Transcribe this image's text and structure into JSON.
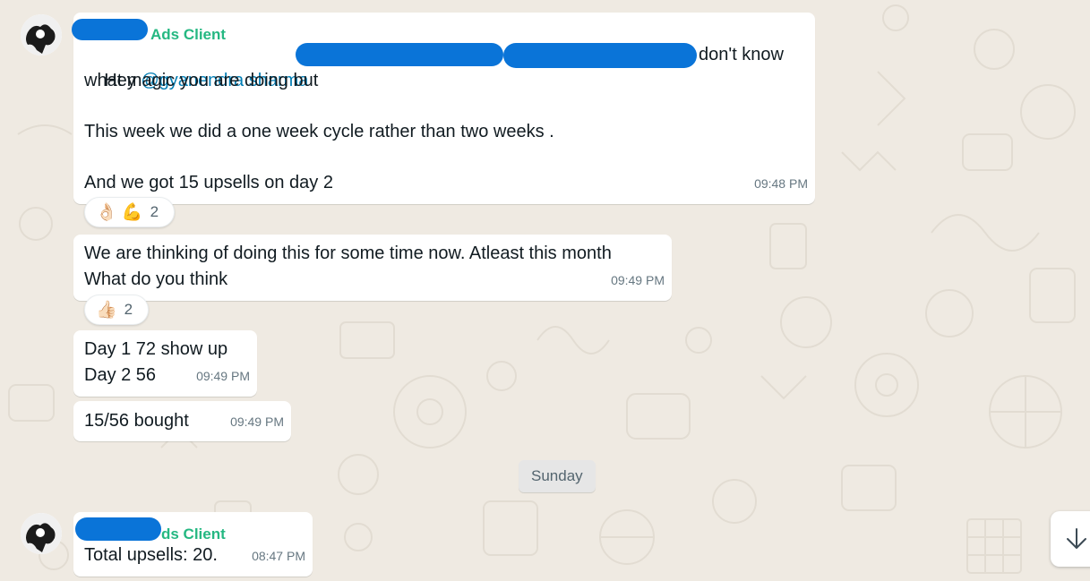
{
  "colors": {
    "background": "#efeae2",
    "bubble": "#ffffff",
    "sender_name": "#25b882",
    "mention": "#027eb5",
    "timestamp": "#667781",
    "redaction": "#0a74d8"
  },
  "messages": [
    {
      "sender": "Ads Client",
      "mention": "@gyanendra sharma",
      "lead": "Hey ",
      "line1_tail": "don't know",
      "line2": "what magic you are doing but",
      "line3": "This week we did a one week cycle rather than two weeks .",
      "line4": "And we got 15 upsells on day 2",
      "time": "09:48 PM",
      "reactions": {
        "emojis": "👌🏻 💪",
        "count": "2"
      }
    },
    {
      "line1": "We are thinking of doing this for some time now. Atleast this month",
      "line2": "What do you think",
      "time": "09:49 PM",
      "reactions": {
        "emojis": "👍🏻",
        "count": "2"
      }
    },
    {
      "line1": "Day 1 72 show up",
      "line2": "Day 2 56",
      "time": "09:49 PM"
    },
    {
      "line1": "15/56 bought",
      "time": "09:49 PM"
    }
  ],
  "day_divider": "Sunday",
  "last_message": {
    "sender": "ds Client",
    "text": "Total upsells: 20.",
    "time": "08:47 PM"
  },
  "icons": {
    "avatar": "avatar-icon",
    "scroll": "arrow-down-icon"
  }
}
